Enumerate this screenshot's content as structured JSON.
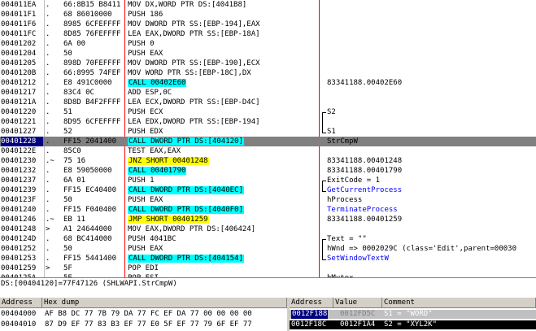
{
  "disasm": {
    "rows": [
      {
        "addr": "004011EA",
        "mark": ".",
        "hex": "66:8B15 B8411",
        "asm": "MOV DX,WORD PTR DS:[4041B8]",
        "asm_bg": "",
        "cmt": ""
      },
      {
        "addr": "004011F1",
        "mark": ".",
        "hex": "68 86010000",
        "asm": "PUSH 186",
        "asm_bg": "",
        "cmt": ""
      },
      {
        "addr": "004011F6",
        "mark": ".",
        "hex": "8985 6CFEFFFF",
        "asm": "MOV DWORD PTR SS:[EBP-194],EAX",
        "asm_bg": "",
        "cmt": ""
      },
      {
        "addr": "004011FC",
        "mark": ".",
        "hex": "8D85 76FEFFFF",
        "asm": "LEA EAX,DWORD PTR SS:[EBP-18A]",
        "asm_bg": "",
        "cmt": ""
      },
      {
        "addr": "00401202",
        "mark": ".",
        "hex": "6A 00",
        "asm": "PUSH 0",
        "asm_bg": "",
        "cmt": ""
      },
      {
        "addr": "00401204",
        "mark": ".",
        "hex": "50",
        "asm": "PUSH EAX",
        "asm_bg": "",
        "cmt": ""
      },
      {
        "addr": "00401205",
        "mark": ".",
        "hex": "898D 70FEFFFF",
        "asm": "MOV DWORD PTR SS:[EBP-190],ECX",
        "asm_bg": "",
        "cmt": ""
      },
      {
        "addr": "0040120B",
        "mark": ".",
        "hex": "66:8995 74FEF",
        "asm": "MOV WORD PTR SS:[EBP-18C],DX",
        "asm_bg": "",
        "cmt": ""
      },
      {
        "addr": "00401212",
        "mark": ".",
        "hex": "E8 491C0000",
        "asm": "CALL 00402E60",
        "asm_bg": "#00ffff",
        "cmt": "83341188.00402E60"
      },
      {
        "addr": "00401217",
        "mark": ".",
        "hex": "83C4 0C",
        "asm": "ADD ESP,0C",
        "asm_bg": "",
        "cmt": ""
      },
      {
        "addr": "0040121A",
        "mark": ".",
        "hex": "8D8D B4F2FFFF",
        "asm": "LEA ECX,DWORD PTR SS:[EBP-D4C]",
        "asm_bg": "",
        "cmt": ""
      },
      {
        "addr": "00401220",
        "mark": ".",
        "hex": "51",
        "asm": "PUSH ECX",
        "asm_bg": "",
        "cmt": "S2"
      },
      {
        "addr": "00401221",
        "mark": ".",
        "hex": "8D95 6CFEFFFF",
        "asm": "LEA EDX,DWORD PTR SS:[EBP-194]",
        "asm_bg": "",
        "cmt": ""
      },
      {
        "addr": "00401227",
        "mark": ".",
        "hex": "52",
        "asm": "PUSH EDX",
        "asm_bg": "",
        "cmt": "S1"
      },
      {
        "addr": "00401228",
        "mark": ".",
        "hex": "FF15 2041400",
        "asm": "CALL DWORD PTR DS:[404120]",
        "asm_bg": "#00ffff",
        "cmt": "StrCmpW"
      },
      {
        "addr": "0040122E",
        "mark": ".",
        "hex": "85C0",
        "asm": "TEST EAX,EAX",
        "asm_bg": "",
        "cmt": ""
      },
      {
        "addr": "00401230",
        "mark": ".~",
        "hex": "75 16",
        "asm": "JNZ SHORT 00401248",
        "asm_bg": "#ffff00",
        "cmt": "83341188.00401248"
      },
      {
        "addr": "00401232",
        "mark": ".",
        "hex": "E8 59050000",
        "asm": "CALL 00401790",
        "asm_bg": "#00ffff",
        "cmt": "83341188.00401790"
      },
      {
        "addr": "00401237",
        "mark": ".",
        "hex": "6A 01",
        "asm": "PUSH 1",
        "asm_bg": "",
        "cmt": "ExitCode = 1"
      },
      {
        "addr": "00401239",
        "mark": ".",
        "hex": "FF15 EC40400",
        "asm": "CALL DWORD PTR DS:[4040EC]",
        "asm_bg": "#00ffff",
        "cmt": "GetCurrentProcess"
      },
      {
        "addr": "0040123F",
        "mark": ".",
        "hex": "50",
        "asm": "PUSH EAX",
        "asm_bg": "",
        "cmt": "hProcess"
      },
      {
        "addr": "00401240",
        "mark": ".",
        "hex": "FF15 F040400",
        "asm": "CALL DWORD PTR DS:[4040F0]",
        "asm_bg": "#00ffff",
        "cmt": "TerminateProcess"
      },
      {
        "addr": "00401246",
        "mark": ".~",
        "hex": "EB 11",
        "asm": "JMP SHORT 00401259",
        "asm_bg": "#ffff00",
        "cmt": "83341188.00401259"
      },
      {
        "addr": "00401248",
        "mark": ">",
        "hex": "A1 24644000",
        "asm": "MOV EAX,DWORD PTR DS:[406424]",
        "asm_bg": "",
        "cmt": ""
      },
      {
        "addr": "0040124D",
        "mark": ".",
        "hex": "68 BC414000",
        "asm": "PUSH 4041BC",
        "asm_bg": "",
        "cmt": "Text = \"\""
      },
      {
        "addr": "00401252",
        "mark": ".",
        "hex": "50",
        "asm": "PUSH EAX",
        "asm_bg": "",
        "cmt": "hWnd => 0002029C (class='Edit',parent=00030"
      },
      {
        "addr": "00401253",
        "mark": ".",
        "hex": "FF15 5441400",
        "asm": "CALL DWORD PTR DS:[404154]",
        "asm_bg": "#00ffff",
        "cmt": "SetWindowTextW"
      },
      {
        "addr": "00401259",
        "mark": ">",
        "hex": "5F",
        "asm": "POP EDI",
        "asm_bg": "",
        "cmt": ""
      },
      {
        "addr": "0040125A",
        "mark": ".",
        "hex": "5E",
        "asm": "POP ESI",
        "asm_bg": "",
        "cmt": "hMutex"
      }
    ]
  },
  "info": {
    "text": "DS:[00404120]=77F47126 (SHLWAPI.StrCmpW)"
  },
  "dump": {
    "headers": {
      "address": "Address",
      "hex": "Hex dump"
    },
    "rows": [
      {
        "addr": "00404000",
        "hex": "AF B8 DC 77 7B 79 DA 77 FC EF DA 77 00 00 00 00"
      },
      {
        "addr": "00404010",
        "hex": "87 D9 EF 77 83 B3 EF 77 E0 5F EF 77 79 6F EF 77"
      }
    ]
  },
  "stack": {
    "headers": {
      "address": "Address",
      "value": "Value",
      "comment": "Comment"
    },
    "rows": [
      {
        "addr": "0012F188",
        "value": "0012FD5C",
        "comment": "S1 = \"WORD\""
      },
      {
        "addr": "0012F18C",
        "value": "0012F1A4",
        "comment": "S2 = \"XYL2K\""
      }
    ]
  }
}
